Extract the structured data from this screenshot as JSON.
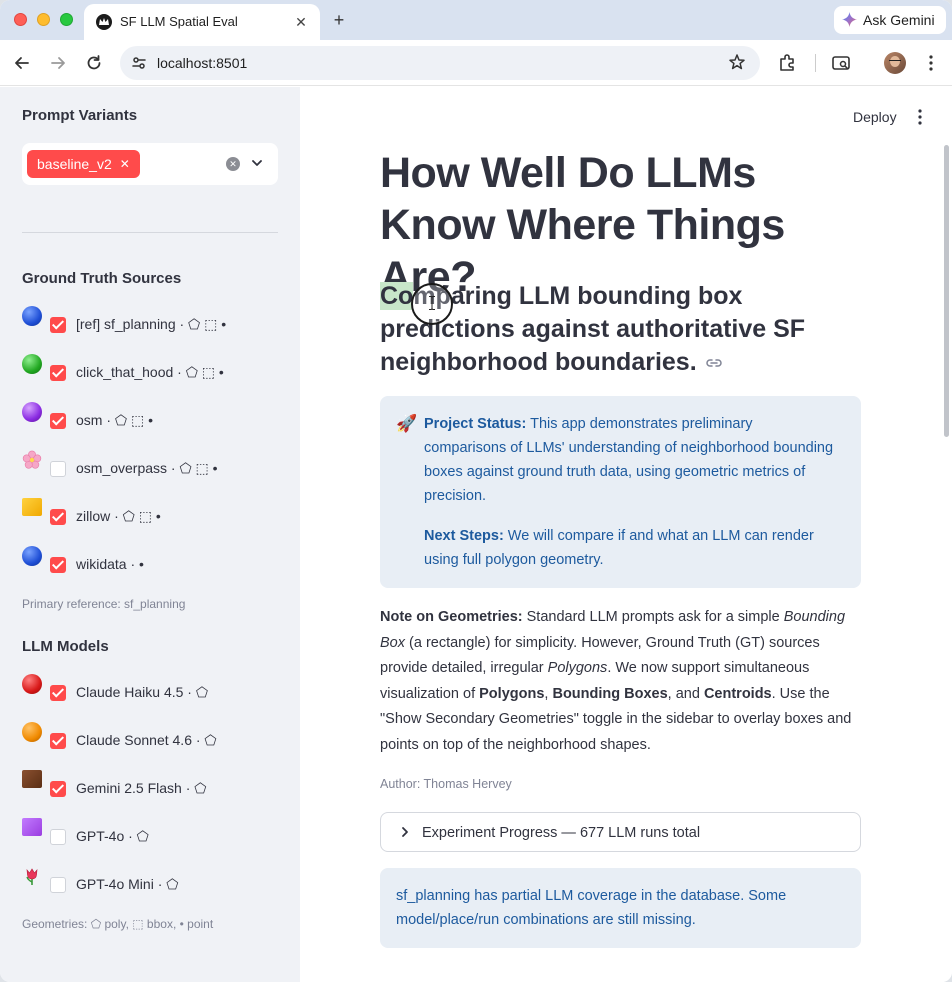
{
  "browser": {
    "tab_title": "SF LLM Spatial Eval",
    "tab_close": "✕",
    "new_tab": "+",
    "ask_gemini": "Ask Gemini",
    "url": "localhost:8501"
  },
  "sidebar": {
    "prompt_variants_title": "Prompt Variants",
    "selected_variant": "baseline_v2",
    "chip_remove": "✕",
    "clear_symbol": "✕",
    "ground_truth_title": "Ground Truth Sources",
    "sources": [
      {
        "label": "[ref] sf_planning · ⬠ ⬚ •",
        "marker": "blue-ball",
        "color": "#1f4fd6",
        "checked": true
      },
      {
        "label": "click_that_hood · ⬠ ⬚ •",
        "marker": "green-ball",
        "color": "#22a822",
        "checked": true
      },
      {
        "label": "osm · ⬠ ⬚ •",
        "marker": "purple-ball",
        "color": "#8a2be2",
        "checked": true
      },
      {
        "label": "osm_overpass · ⬠ ⬚ •",
        "marker": "cherry-blossom",
        "color": "#f6a7c7",
        "checked": false
      },
      {
        "label": "zillow · ⬠ ⬚ •",
        "marker": "yellow-square",
        "color": "#f5b800",
        "checked": true
      },
      {
        "label": "wikidata · •",
        "marker": "blue-ball",
        "color": "#1f4fd6",
        "checked": true
      }
    ],
    "primary_reference": "Primary reference: sf_planning",
    "llm_models_title": "LLM Models",
    "models": [
      {
        "label": "Claude Haiku 4.5 · ⬠",
        "marker": "red-ball",
        "color": "#d81818",
        "checked": true
      },
      {
        "label": "Claude Sonnet 4.6 · ⬠",
        "marker": "orange-ball",
        "color": "#f08a00",
        "checked": true
      },
      {
        "label": "Gemini 2.5 Flash · ⬠",
        "marker": "brown-square",
        "color": "#6b3a1e",
        "checked": true
      },
      {
        "label": "GPT-4o · ⬠",
        "marker": "purple-square",
        "color": "#a347e8",
        "checked": false
      },
      {
        "label": "GPT-4o Mini · ⬠",
        "marker": "tulip",
        "color": "#e8365a",
        "checked": false
      }
    ],
    "geometries_caption": "Geometries: ⬠ poly, ⬚ bbox, • point"
  },
  "main": {
    "deploy": "Deploy",
    "title": "How Well Do LLMs Know Where Things Are?",
    "subtitle_highlight": "Co",
    "subtitle_rest": "mparing LLM bounding box predictions against authoritative SF neighborhood boundaries.",
    "info": {
      "icon": "🚀",
      "status_label": "Project Status:",
      "status_text": " This app demonstrates preliminary comparisons of LLMs' understanding of neighborhood bounding boxes against ground truth data, using geometric metrics of precision.",
      "next_label": "Next Steps:",
      "next_text": " We will compare if and what an LLM can render using full polygon geometry."
    },
    "note": {
      "label": "Note on Geometries:",
      "t1": " Standard LLM prompts ask for a simple ",
      "i1": "Bounding Box",
      "t2": " (a rectangle) for simplicity. However, Ground Truth (GT) sources provide detailed, irregular ",
      "i2": "Polygons",
      "t3": ". We now support simultaneous visualization of ",
      "b1": "Polygons",
      "t4": ", ",
      "b2": "Bounding Boxes",
      "t5": ", and ",
      "b3": "Centroids",
      "t6": ". Use the \"Show Secondary Geometries\" toggle in the sidebar to overlay boxes and points on top of the neighborhood shapes."
    },
    "author": "Author: Thomas Hervey",
    "expander_label": "Experiment Progress — 677 LLM runs total",
    "coverage_note": "sf_planning has partial LLM coverage in the database. Some model/place/run combinations are still missing."
  }
}
